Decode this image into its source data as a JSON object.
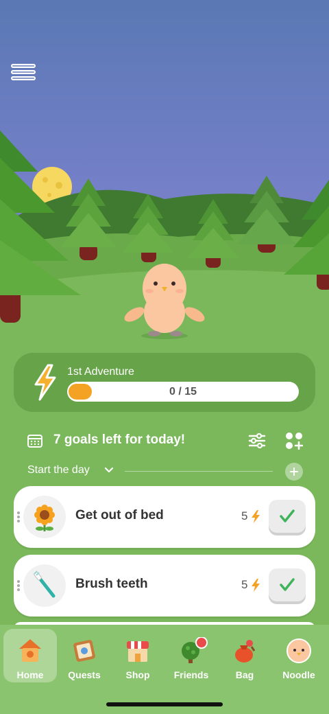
{
  "header": {
    "menu_icon": "hamburger-menu-icon"
  },
  "adventure": {
    "title": "1st Adventure",
    "progress_text": "0 / 15",
    "progress": 0,
    "icon": "lightning-bolt-icon",
    "accent_color": "#f3a223"
  },
  "goals": {
    "summary": "7 goals left for today!",
    "calendar_icon": "calendar-icon",
    "filter_icon": "filter-sliders-icon",
    "layout_icon": "add-widget-grid-icon"
  },
  "section": {
    "label": "Start the day",
    "chevron_icon": "chevron-down-icon",
    "add_icon": "plus-icon"
  },
  "tasks": [
    {
      "title": "Get out of bed",
      "energy": "5",
      "icon": "sunflower-icon",
      "check_icon": "checkmark-icon"
    },
    {
      "title": "Brush teeth",
      "energy": "5",
      "icon": "toothbrush-icon",
      "check_icon": "checkmark-icon"
    }
  ],
  "nav": [
    {
      "label": "Home",
      "icon": "birdhouse-icon",
      "active": true
    },
    {
      "label": "Quests",
      "icon": "quest-board-icon",
      "active": false
    },
    {
      "label": "Shop",
      "icon": "shop-icon",
      "active": false
    },
    {
      "label": "Friends",
      "icon": "friends-tree-icon",
      "active": false,
      "badge": true
    },
    {
      "label": "Bag",
      "icon": "bag-icon",
      "active": false
    },
    {
      "label": "Noodle",
      "icon": "noodle-face-icon",
      "active": false
    }
  ],
  "colors": {
    "sky_top": "#5a78b4",
    "sky_bottom": "#7f84d2",
    "grass": "#7bb85c",
    "check_green": "#3fb35a"
  }
}
